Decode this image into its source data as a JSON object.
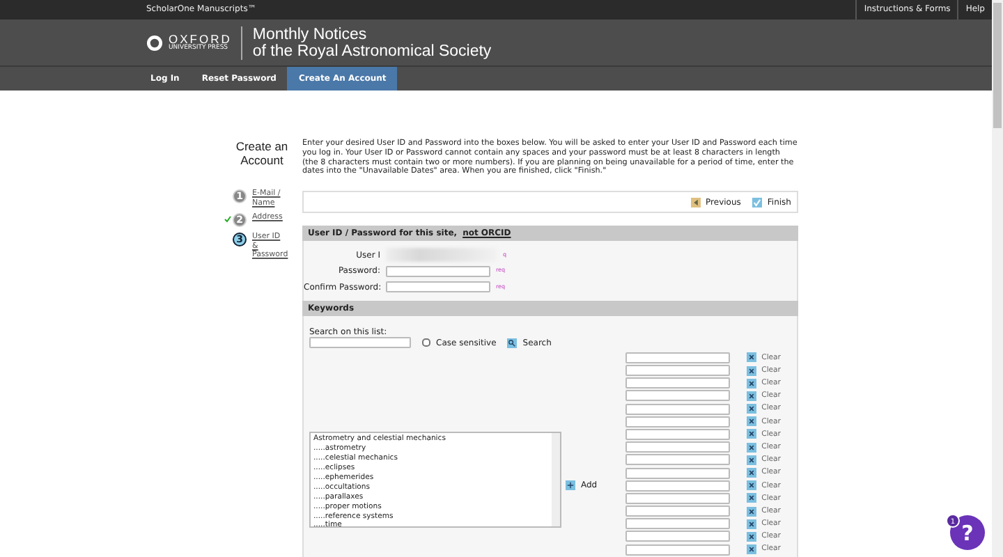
{
  "topbar": {
    "brand": "ScholarOne Manuscripts™",
    "links": [
      "Instructions & Forms",
      "Help"
    ]
  },
  "header": {
    "publisher": "OXFORD",
    "publisher_sub": "UNIVERSITY PRESS",
    "journal": [
      "Monthly Notices",
      "of the Royal Astronomical Society"
    ]
  },
  "nav": [
    {
      "label": "Log In",
      "selected": false
    },
    {
      "label": "Reset Password",
      "selected": false
    },
    {
      "label": "Create An Account",
      "selected": true
    }
  ],
  "page_title": "Create an Account",
  "steps": [
    {
      "number": "1",
      "label": "E-Mail / Name",
      "completed": false,
      "current": false
    },
    {
      "number": "2",
      "label": "Address",
      "completed": true,
      "current": false
    },
    {
      "number": "3",
      "label": "User ID & Password",
      "completed": false,
      "current": true
    }
  ],
  "instructions": "Enter your desired User ID and Password into the boxes below. You will be asked to enter your User ID and Password each time you log in. Your User ID or Password cannot contain any spaces and your password must be at least 8 characters in length (the 8 characters must contain two or more numbers). If you are planning on being unavailable for a period of time, enter the dates into the \"Unavailable Dates\" area. When you are finished, click \"Finish.\"",
  "buttons": [
    {
      "kind": "previous",
      "label": "Previous"
    },
    {
      "kind": "finish",
      "label": "Finish"
    }
  ],
  "account_section": {
    "title": "User ID / Password for this site,",
    "title_link": "not ORCID",
    "fields": [
      {
        "label": "User I",
        "redacted": true,
        "required": "q"
      },
      {
        "label": "Password:",
        "redacted": false,
        "required": "req"
      },
      {
        "label": "Confirm Password:",
        "redacted": false,
        "required": "req"
      }
    ]
  },
  "keywords": {
    "title": "Keywords",
    "search_label": "Search on this list:",
    "case_sensitive": {
      "label": "Case sensitive",
      "checked": false
    },
    "search_button": "Search",
    "list_items": [
      "Astrometry and celestial mechanics",
      ".....astrometry",
      ".....celestial mechanics",
      ".....eclipses",
      ".....ephemerides",
      ".....occultations",
      ".....parallaxes",
      ".....proper motions",
      ".....reference systems",
      ".....time"
    ],
    "add_button": "Add",
    "slots": [
      {
        "clear": "Clear"
      },
      {
        "clear": "Clear"
      },
      {
        "clear": "Clear"
      },
      {
        "clear": "Clear"
      },
      {
        "clear": "Clear"
      },
      {
        "clear": "Clear"
      },
      {
        "clear": "Clear"
      },
      {
        "clear": "Clear"
      },
      {
        "clear": "Clear"
      },
      {
        "clear": "Clear"
      },
      {
        "clear": "Clear"
      },
      {
        "clear": "Clear"
      },
      {
        "clear": "Clear"
      },
      {
        "clear": "Clear"
      },
      {
        "clear": "Clear"
      },
      {
        "clear": "Clear"
      }
    ]
  },
  "help_widget": {
    "badge": "1",
    "label": "?"
  }
}
